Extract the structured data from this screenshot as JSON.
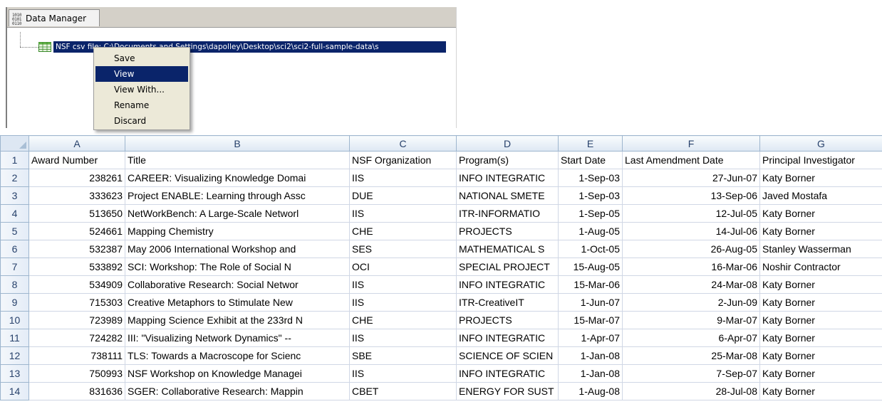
{
  "data_manager": {
    "tab_label": "Data Manager",
    "tab_icon": "binary-bits-icon",
    "node_label": "NSF csv file: C:\\Documents and Settings\\dapolley\\Desktop\\sci2\\sci2-full-sample-data\\s",
    "node_icon": "spreadsheet-icon",
    "context_menu": {
      "items": [
        "Save",
        "View",
        "View With...",
        "Rename",
        "Discard"
      ],
      "selected": "View"
    }
  },
  "sheet": {
    "column_letters": [
      "A",
      "B",
      "C",
      "D",
      "E",
      "F",
      "G"
    ],
    "row_numbers": [
      "1",
      "2",
      "3",
      "4",
      "5",
      "6",
      "7",
      "8",
      "9",
      "10",
      "11",
      "12",
      "13",
      "14"
    ],
    "header": [
      "Award Number",
      "Title",
      "NSF Organization",
      "Program(s)",
      "Start Date",
      "Last Amendment Date",
      "Principal Investigator"
    ],
    "rows": [
      [
        "238261",
        "CAREER: Visualizing Knowledge Domai",
        "IIS",
        "INFO INTEGRATIC",
        "1-Sep-03",
        "27-Jun-07",
        "Katy Borner"
      ],
      [
        "333623",
        "Project ENABLE: Learning through Assc",
        "DUE",
        "NATIONAL SMETE",
        "1-Sep-03",
        "13-Sep-06",
        "Javed Mostafa"
      ],
      [
        "513650",
        "NetWorkBench: A Large-Scale Networl",
        "IIS",
        "ITR-INFORMATIO",
        "1-Sep-05",
        "12-Jul-05",
        "Katy Borner"
      ],
      [
        "524661",
        "Mapping Chemistry",
        "CHE",
        "PROJECTS",
        "1-Aug-05",
        "14-Jul-06",
        "Katy Borner"
      ],
      [
        "532387",
        "May 2006 International Workshop and",
        "SES",
        "MATHEMATICAL S",
        "1-Oct-05",
        "26-Aug-05",
        "Stanley Wasserman"
      ],
      [
        "533892",
        "SCI:   Workshop:   The Role of Social N",
        "OCI",
        "SPECIAL PROJECT",
        "15-Aug-05",
        "16-Mar-06",
        "Noshir Contractor"
      ],
      [
        "534909",
        "Collaborative Research: Social Networ",
        "IIS",
        "INFO INTEGRATIC",
        "15-Mar-06",
        "24-Mar-08",
        "Katy Borner"
      ],
      [
        "715303",
        "Creative Metaphors to Stimulate New",
        "IIS",
        "ITR-CreativeIT",
        "1-Jun-07",
        "2-Jun-09",
        "Katy Borner"
      ],
      [
        "723989",
        "Mapping Science Exhibit at the 233rd N",
        "CHE",
        "PROJECTS",
        "15-Mar-07",
        "9-Mar-07",
        "Katy Borner"
      ],
      [
        "724282",
        "III: \"Visualizing Network Dynamics\" --",
        "IIS",
        "INFO INTEGRATIC",
        "1-Apr-07",
        "6-Apr-07",
        "Katy Borner"
      ],
      [
        "738111",
        "TLS:  Towards a Macroscope for Scienc",
        "SBE",
        "SCIENCE OF SCIEN",
        "1-Jan-08",
        "25-Mar-08",
        "Katy Borner"
      ],
      [
        "750993",
        "NSF Workshop on Knowledge Managei",
        "IIS",
        "INFO INTEGRATIC",
        "1-Jan-08",
        "7-Sep-07",
        "Katy Borner"
      ],
      [
        "831636",
        "SGER: Collaborative Research: Mappin",
        "CBET",
        "ENERGY FOR SUST",
        "1-Aug-08",
        "28-Jul-08",
        "Katy Borner"
      ]
    ]
  },
  "colors": {
    "selection": "#0a246a",
    "header_text": "#27416b",
    "grid_line": "#d0d7e5"
  }
}
